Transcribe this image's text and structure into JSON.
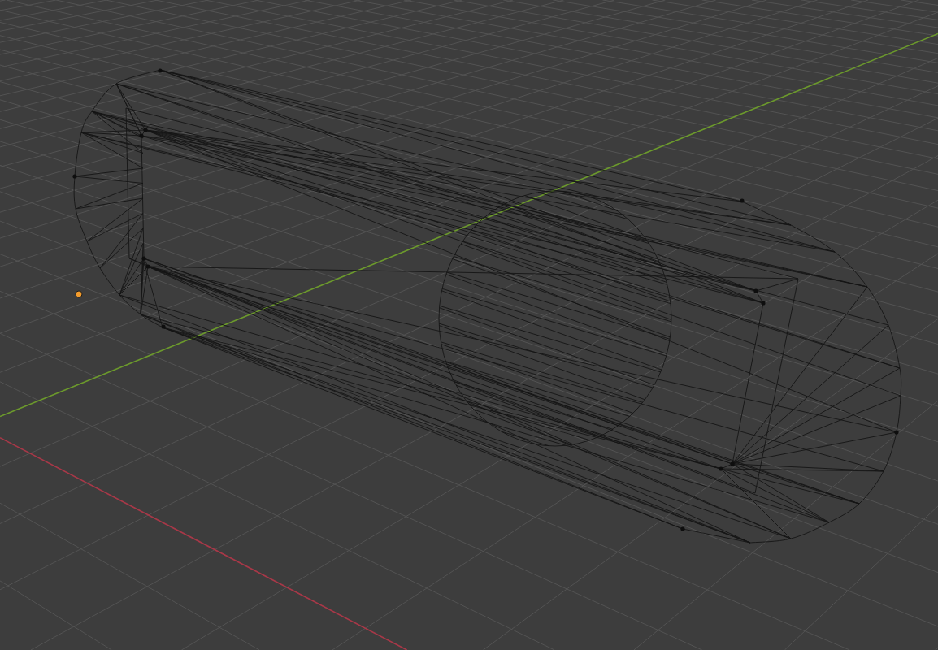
{
  "viewport": {
    "axes": [
      {
        "kind": "x",
        "color": "#a83848"
      },
      {
        "kind": "y",
        "color": "#6c9a2c"
      }
    ]
  }
}
